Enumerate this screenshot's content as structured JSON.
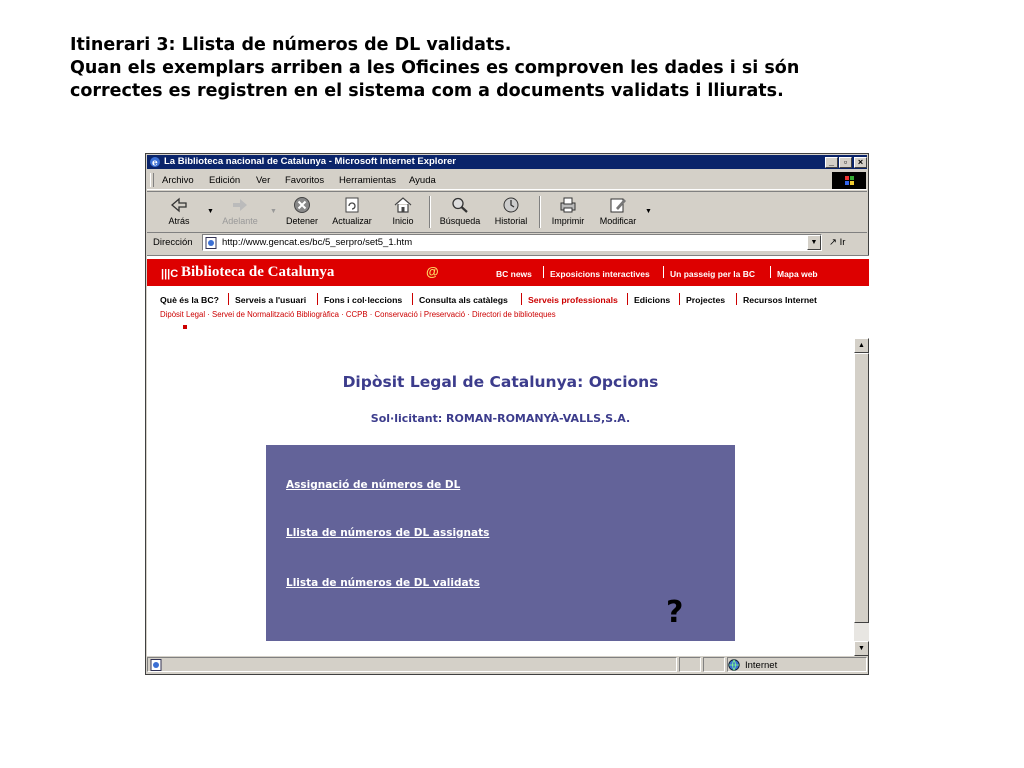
{
  "caption": {
    "line1": "Itinerari 3: Llista de números de DL validats.",
    "line2": "Quan els exemplars arriben a les Oficines es comproven les dades i si són",
    "line3": "correctes es registren en el sistema com a documents validats i lliurats."
  },
  "browser": {
    "title": "La Biblioteca nacional de Catalunya - Microsoft Internet Explorer",
    "menu": [
      "Archivo",
      "Edición",
      "Ver",
      "Favoritos",
      "Herramientas",
      "Ayuda"
    ],
    "toolbar": [
      "Atrás",
      "Adelante",
      "Detener",
      "Actualizar",
      "Inicio",
      "Búsqueda",
      "Historial",
      "Imprimir",
      "Modificar"
    ],
    "address_label": "Dirección",
    "url": "http://www.gencat.es/bc/5_serpro/set5_1.htm",
    "go_label": "Ir",
    "status_zone": "Internet",
    "icons": {
      "back": "arrow-left-icon",
      "forward": "arrow-right-icon",
      "stop": "stop-icon",
      "refresh": "refresh-icon",
      "home": "home-icon",
      "search": "search-icon",
      "history": "history-icon",
      "print": "printer-icon",
      "edit": "edit-icon"
    }
  },
  "site": {
    "logo_mark": "|||C",
    "logo": "Biblioteca de Catalunya",
    "at": "@",
    "banner_links": [
      "BC news",
      "Exposicions interactives",
      "Un passeig per la BC",
      "Mapa web"
    ],
    "nav": [
      "Què és la BC?",
      "Serveis a l'usuari",
      "Fons i col·leccions",
      "Consulta als catàlegs",
      "Serveis professionals",
      "Edicions",
      "Projectes",
      "Recursos Internet"
    ],
    "active_nav": "Serveis professionals",
    "subnav": "Dipòsit Legal  ·  Servei de Normalització Bibliogràfica  ·  CCPB  ·  Conservació i Preservació  ·  Directori de biblioteques",
    "colors": {
      "banner": "#dd0000",
      "accent": "#cc0000",
      "title": "#3c3c8c",
      "options_bg": "#636399"
    }
  },
  "page": {
    "title": "Dipòsit Legal de Catalunya: Opcions",
    "requester": "Sol·licitant: ROMAN-ROMANYÀ-VALLS,S.A.",
    "options": [
      "Assignació de números de DL",
      "Llista de números de DL assignats",
      "Llista de números de DL validats"
    ],
    "help_mark": "?"
  }
}
